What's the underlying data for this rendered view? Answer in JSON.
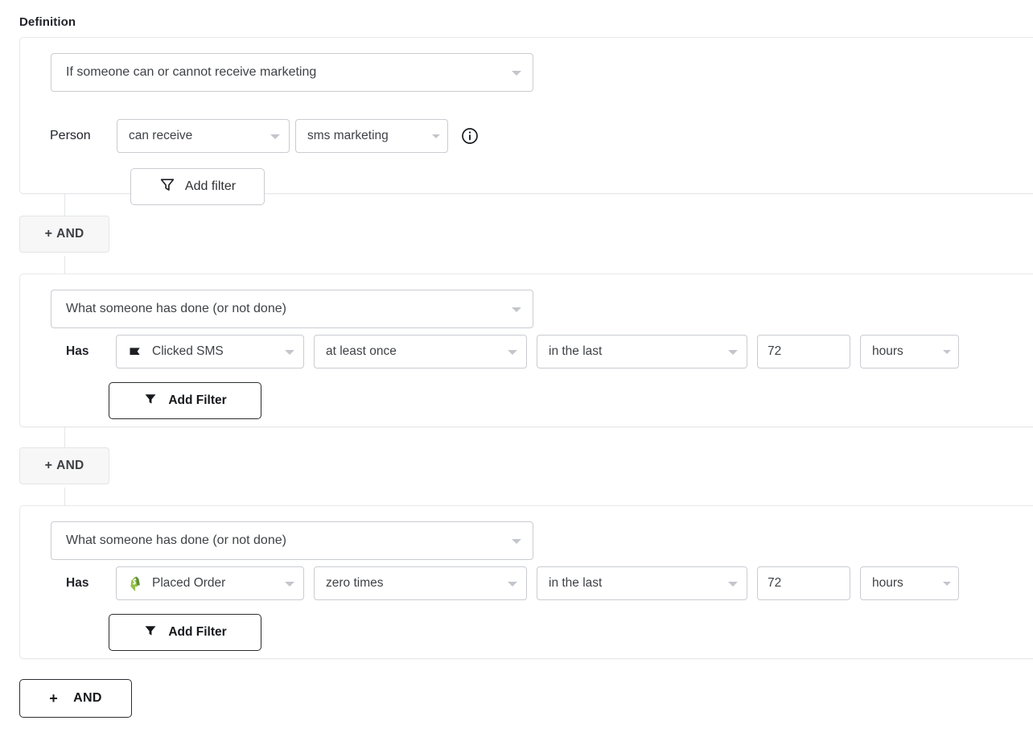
{
  "section": {
    "title": "Definition"
  },
  "blocks": [
    {
      "type_label": "If someone can or cannot receive marketing",
      "row_label": "Person",
      "controls": {
        "permission": "can receive",
        "channel": "sms marketing"
      },
      "info_icon": "info-circle-icon",
      "add_filter_label": "Add filter",
      "filter_icon": "funnel-outline-icon"
    },
    {
      "type_label": "What someone has done (or not done)",
      "row_label": "Has",
      "controls": {
        "metric": "Clicked SMS",
        "metric_icon": "sms-flag-icon",
        "count": "at least once",
        "timeframe": "in the last",
        "value": "72",
        "unit": "hours"
      },
      "add_filter_label": "Add Filter",
      "filter_icon": "funnel-solid-icon"
    },
    {
      "type_label": "What someone has done (or not done)",
      "row_label": "Has",
      "controls": {
        "metric": "Placed Order",
        "metric_icon": "shopify-bag-icon",
        "count": "zero times",
        "timeframe": "in the last",
        "value": "72",
        "unit": "hours"
      },
      "add_filter_label": "Add Filter",
      "filter_icon": "funnel-solid-icon"
    }
  ],
  "connectors": [
    {
      "plus": "+",
      "label": "AND"
    },
    {
      "plus": "+",
      "label": "AND"
    }
  ],
  "footer": {
    "plus": "+",
    "and_label": "AND"
  },
  "colors": {
    "shopify_green": "#95bf47",
    "shopify_green_dark": "#5e8e3e",
    "border": "#c9ccd1",
    "card_border": "#e6e8eb",
    "text": "#3f4246",
    "strong_border": "#2b2d31"
  }
}
